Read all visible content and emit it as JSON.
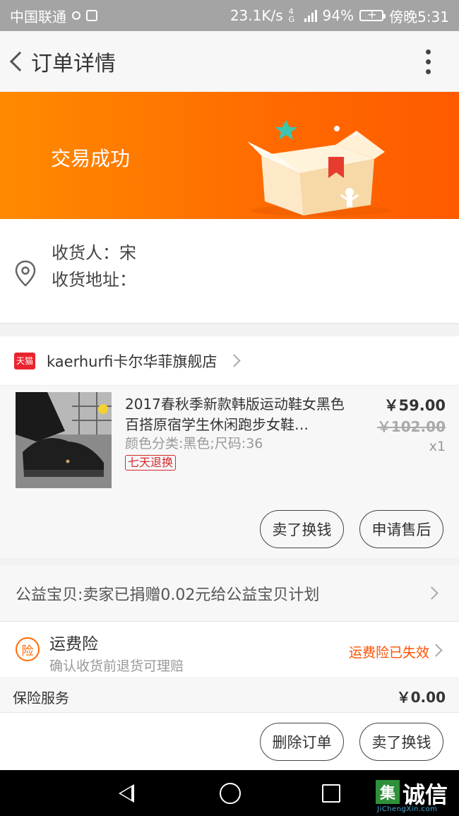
{
  "status_bar": {
    "carrier": "中国联通",
    "speed": "23.1K/s",
    "network": "4G",
    "battery": "94%",
    "time": "傍晚5:31"
  },
  "nav": {
    "title": "订单详情"
  },
  "banner": {
    "status_text": "交易成功"
  },
  "address": {
    "receiver_line": "收货人：宋",
    "address_line": "收货地址："
  },
  "store": {
    "badge": "天猫",
    "name": "kaerhurfi卡尔华菲旗舰店"
  },
  "item": {
    "title": "2017春秋季新款韩版运动鞋女黑色百搭原宿学生休闲跑步女鞋…",
    "spec": "颜色分类:黑色;尺码:36",
    "badge": "七天退换",
    "price": "￥59.00",
    "original_price": "￥102.00",
    "quantity": "x1",
    "sell_button": "卖了换钱",
    "after_sale_button": "申请售后"
  },
  "charity": {
    "text": "公益宝贝:卖家已捐赠0.02元给公益宝贝计划"
  },
  "freight": {
    "icon_char": "险",
    "title": "运费险",
    "subtitle": "确认收货前退货可理赔",
    "status": "运费险已失效"
  },
  "insurance": {
    "label": "保险服务",
    "value": "￥0.00"
  },
  "bottom_bar": {
    "delete_button": "删除订单",
    "sell_button": "卖了换钱"
  },
  "watermark": {
    "logo_char": "集",
    "text": "诚信",
    "url": "JiChengXin.com"
  },
  "colors": {
    "accent": "#ff6a00",
    "badge_red": "#d8262c",
    "tmall_red": "#e8242f"
  }
}
